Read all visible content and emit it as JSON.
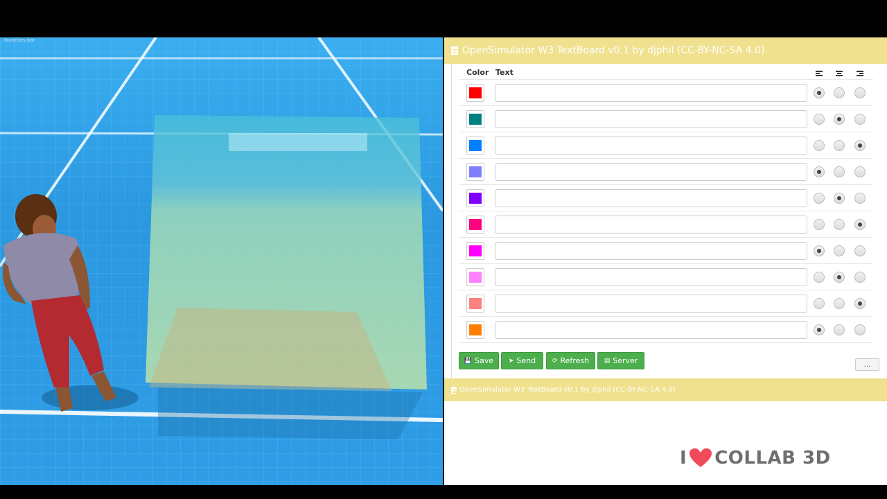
{
  "viewport": {
    "title": "favorites bar"
  },
  "panel": {
    "header_title": "OpenSimulator W3 TextBoard v0.1 by djphil (CC-BY-NC-SA 4.0)",
    "col_color": "Color",
    "col_text": "Text",
    "rows": [
      {
        "color": "#ff0000",
        "align": "left",
        "text": ""
      },
      {
        "color": "#008080",
        "align": "center",
        "text": ""
      },
      {
        "color": "#0080ff",
        "align": "right",
        "text": ""
      },
      {
        "color": "#8080ff",
        "align": "left",
        "text": ""
      },
      {
        "color": "#8000ff",
        "align": "center",
        "text": ""
      },
      {
        "color": "#ff0080",
        "align": "right",
        "text": ""
      },
      {
        "color": "#ff00ff",
        "align": "left",
        "text": ""
      },
      {
        "color": "#ff80ff",
        "align": "center",
        "text": ""
      },
      {
        "color": "#ff8080",
        "align": "right",
        "text": ""
      },
      {
        "color": "#ff8000",
        "align": "left",
        "text": ""
      }
    ],
    "buttons": {
      "save": "Save",
      "send": "Send",
      "refresh": "Refresh",
      "server": "Server",
      "more": "..."
    },
    "footer_title": "OpenSimulator W3 TextBoard v0.1 by djphil (CC-BY-NC-SA 4.0)"
  },
  "logo": {
    "prefix": "I",
    "suffix": "COLLAB 3D",
    "heart_color": "#f04b5a"
  },
  "colors": {
    "header_bg": "#efe18e",
    "button_green": "#4cae4c",
    "sky_blue": "#2f9de6"
  }
}
